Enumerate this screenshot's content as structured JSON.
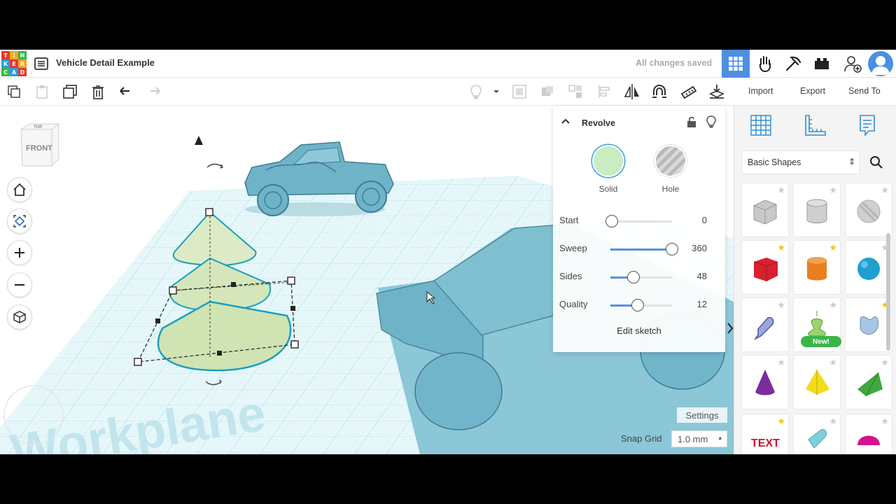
{
  "header": {
    "logo_letters": [
      "T",
      "I",
      "N",
      "K",
      "E",
      "R",
      "C",
      "A",
      "D"
    ],
    "logo_colors": [
      "#e2392d",
      "#f5a623",
      "#3bb54a",
      "#2d9be2",
      "#e2392d",
      "#f5a623",
      "#3bb54a",
      "#2d9be2",
      "#e2392d"
    ],
    "design_title": "Vehicle Detail Example",
    "save_status": "All changes saved",
    "buttons": [
      "grid-view-icon",
      "tinker-icon",
      "build-icon",
      "bricks-icon",
      "add-user-icon"
    ]
  },
  "toolbar": {
    "left_tools": [
      "copy-icon",
      "paste-icon",
      "duplicate-icon",
      "delete-icon",
      "undo-icon",
      "redo-icon"
    ],
    "right_tools": [
      "note-icon",
      "group-icon",
      "ungroup-icon",
      "align-icon",
      "mirror-icon",
      "cruise-icon",
      "ruler-icon",
      "drop-icon"
    ],
    "import": "Import",
    "export": "Export",
    "send_to": "Send To"
  },
  "viewcube": {
    "top": "TOP",
    "front": "FRONT"
  },
  "nav": [
    "home-view-icon",
    "fit-view-icon",
    "zoom-in-icon",
    "zoom-out-icon",
    "projection-icon"
  ],
  "workplane_label": "Workplane",
  "inspector": {
    "title": "Revolve",
    "solid": "Solid",
    "hole": "Hole",
    "solid_color": "#c9ecc2",
    "params": [
      {
        "label": "Start",
        "value": "0",
        "fraction": 0.0
      },
      {
        "label": "Sweep",
        "value": "360",
        "fraction": 1.0
      },
      {
        "label": "Sides",
        "value": "48",
        "fraction": 0.38
      },
      {
        "label": "Quality",
        "value": "12",
        "fraction": 0.44
      }
    ],
    "edit_sketch": "Edit sketch"
  },
  "settings": "Settings",
  "snap": {
    "label": "Snap Grid",
    "value": "1.0 mm"
  },
  "panel": {
    "tabs": [
      "grid-icon",
      "ruler-corner-icon",
      "notes-icon"
    ],
    "library": "Basic Shapes",
    "new_badge": "New!",
    "shapes": [
      {
        "name": "box-hole",
        "starred": false
      },
      {
        "name": "cylinder-hole",
        "starred": false
      },
      {
        "name": "sphere-hole",
        "starred": false
      },
      {
        "name": "box",
        "starred": true
      },
      {
        "name": "cylinder",
        "starred": true
      },
      {
        "name": "sphere",
        "starred": false
      },
      {
        "name": "scribble",
        "starred": false
      },
      {
        "name": "revolve",
        "starred": false
      },
      {
        "name": "shape-generator",
        "starred": true
      },
      {
        "name": "cone",
        "starred": false
      },
      {
        "name": "pyramid",
        "starred": false
      },
      {
        "name": "wedge",
        "starred": false
      },
      {
        "name": "text",
        "starred": true
      },
      {
        "name": "tube",
        "starred": false
      },
      {
        "name": "half-sphere",
        "starred": false
      }
    ]
  }
}
